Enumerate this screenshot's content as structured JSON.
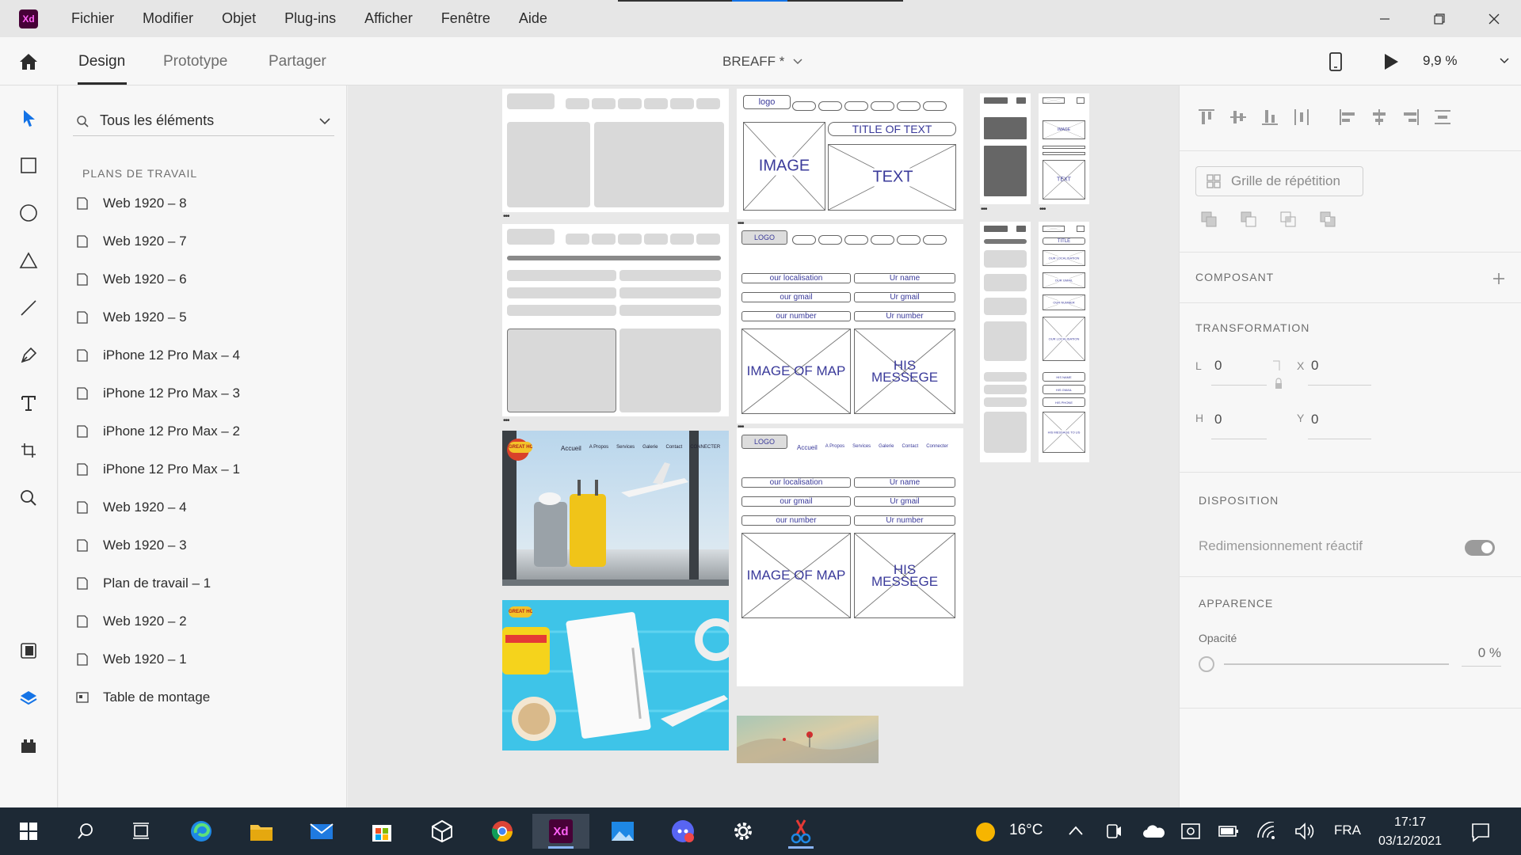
{
  "app": {
    "logo_text": "Xd"
  },
  "menu": [
    "Fichier",
    "Modifier",
    "Objet",
    "Plug-ins",
    "Afficher",
    "Fenêtre",
    "Aide"
  ],
  "modes": {
    "design": "Design",
    "prototype": "Prototype",
    "share": "Partager"
  },
  "document": {
    "title": "BREAFF *"
  },
  "zoom": {
    "value": "9,9 %"
  },
  "layers": {
    "search_value": "Tous les éléments",
    "section_title": "PLANS DE TRAVAIL",
    "items": [
      "Web 1920 – 8",
      "Web 1920 – 7",
      "Web 1920 – 6",
      "Web 1920 – 5",
      "iPhone 12 Pro Max – 4",
      "iPhone 12 Pro Max – 3",
      "iPhone 12 Pro Max – 2",
      "iPhone 12 Pro Max – 1",
      "Web 1920 – 4",
      "Web 1920 – 3",
      "Plan de travail – 1",
      "Web 1920 – 2",
      "Web 1920 – 1"
    ],
    "pasteboard": "Table de montage"
  },
  "canvas": {
    "wireframe1": {
      "logo": "logo",
      "title": "TITLE OF TEXT",
      "image": "IMAGE",
      "text": "TEXT"
    },
    "wireframe2": {
      "logo": "LOGO",
      "fields_left": [
        "our localisation",
        "our gmail",
        "our number"
      ],
      "fields_right": [
        "Ur name",
        "Ur gmail",
        "Ur number"
      ],
      "map": "IMAGE OF MAP",
      "message": "HIS MESSEGE"
    },
    "wireframe3": {
      "logo": "LOGO",
      "nav": [
        "Accueil",
        "A Propos",
        "Services",
        "Galerie",
        "Contact",
        "Connecter"
      ],
      "fields_left": [
        "our localisation",
        "our gmail",
        "our number"
      ],
      "fields_right": [
        "Ur name",
        "Ur gmail",
        "Ur number"
      ],
      "map": "IMAGE OF MAP",
      "message": "HIS MESSEGE"
    },
    "photo1": {
      "badge": "GREAT HOLIDAY",
      "nav": [
        "Accueil",
        "A Propos",
        "Services",
        "Galerie",
        "Contact",
        "CONNECTER"
      ]
    },
    "photo2": {
      "badge": "GREAT HOLIDAY"
    },
    "mobile_wf": {
      "image": "IMAGE",
      "text": "TEXT",
      "title": "TITLE",
      "fields": [
        "OUR LOCALISATION",
        "OUR GMAIL",
        "OUR NUMBER"
      ],
      "map": "OUR LOCALISATION",
      "right": [
        "HIS NAME",
        "HIS GMAIL",
        "HIS PHONE"
      ],
      "msg": "HIS MESSAGE TO US"
    }
  },
  "inspector": {
    "repeat_grid": "Grille de répétition",
    "component": "COMPOSANT",
    "transform": "TRANSFORMATION",
    "w_label": "L",
    "w": "0",
    "x_label": "X",
    "x": "0",
    "h_label": "H",
    "h": "0",
    "y_label": "Y",
    "y": "0",
    "layout": "DISPOSITION",
    "responsive": "Redimensionnement réactif",
    "appearance": "APPARENCE",
    "opacity_label": "Opacité",
    "opacity": "0 %"
  },
  "taskbar": {
    "temperature": "16°C",
    "language": "FRA",
    "time": "17:17",
    "date": "03/12/2021"
  }
}
